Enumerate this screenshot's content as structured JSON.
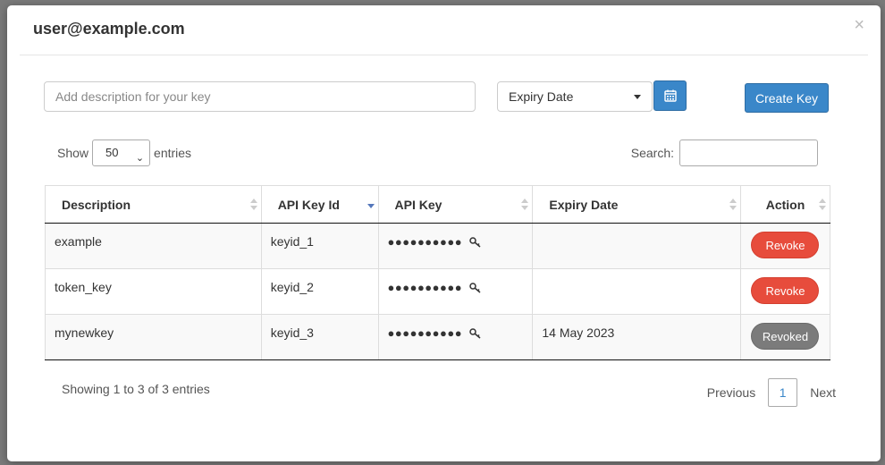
{
  "modal": {
    "title": "user@example.com",
    "close": "×"
  },
  "form": {
    "description_placeholder": "Add description for your key",
    "description_value": "",
    "expiry_label": "Expiry Date",
    "calendar_icon": "calendar-icon",
    "create_label": "Create Key"
  },
  "controls": {
    "show_label": "Show",
    "entries_value": "50",
    "entries_label": "entries",
    "search_label": "Search:",
    "search_value": ""
  },
  "table": {
    "columns": [
      "Description",
      "API Key Id",
      "API Key",
      "Expiry Date",
      "Action"
    ],
    "sorted_column": "API Key Id",
    "rows": [
      {
        "description": "example",
        "key_id": "keyid_1",
        "api_key": "●●●●●●●●●●",
        "expiry": "",
        "action": "Revoke"
      },
      {
        "description": "token_key",
        "key_id": "keyid_2",
        "api_key": "●●●●●●●●●●",
        "expiry": "",
        "action": "Revoke"
      },
      {
        "description": "mynewkey",
        "key_id": "keyid_3",
        "api_key": "●●●●●●●●●●",
        "expiry": "14 May 2023",
        "action": "Revoked"
      }
    ]
  },
  "footer": {
    "info": "Showing 1 to 3 of 3 entries",
    "previous": "Previous",
    "current_page": "1",
    "next": "Next"
  },
  "colors": {
    "primary": "#3a87c9",
    "revoke": "#e74c3c",
    "revoked": "#7b7b7b"
  }
}
